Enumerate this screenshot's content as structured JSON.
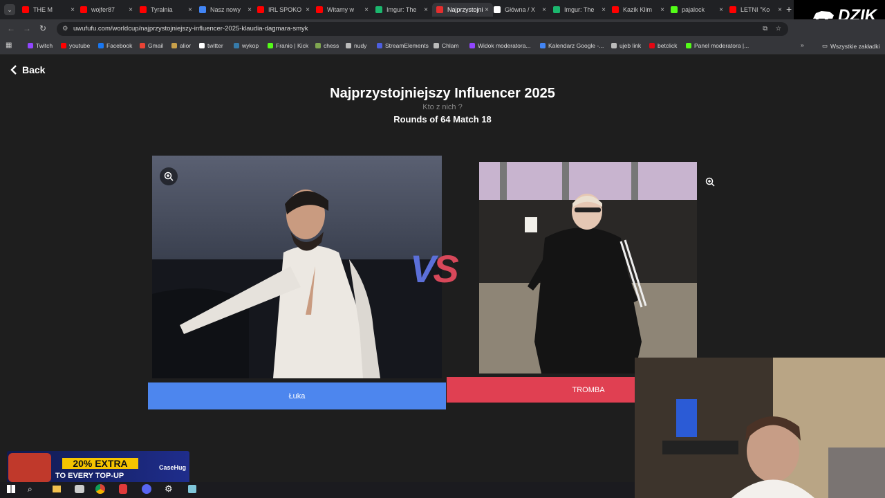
{
  "tabs": [
    {
      "label": "THE M",
      "color": "#ff0000"
    },
    {
      "label": "wojfer87",
      "color": "#ff0000"
    },
    {
      "label": "Tyralnia",
      "color": "#ff0000"
    },
    {
      "label": "Nasz nowy",
      "color": "#4285f4"
    },
    {
      "label": "IRL SPOKO",
      "color": "#ff0000"
    },
    {
      "label": "Witamy w",
      "color": "#ff0000"
    },
    {
      "label": "Imgur: The",
      "color": "#1bb76e"
    },
    {
      "label": "Najprzystojniejszy",
      "color": "#e52e2e",
      "active": true
    },
    {
      "label": "Główna / X",
      "color": "#ffffff"
    },
    {
      "label": "Imgur: The",
      "color": "#1bb76e"
    },
    {
      "label": "Kazik Klim",
      "color": "#ff0000"
    },
    {
      "label": "pajalock",
      "color": "#53fc18"
    },
    {
      "label": "LETNI \"Ko",
      "color": "#ff0000"
    }
  ],
  "address": {
    "url": "uwufufu.com/worldcup/najprzystojniejszy-influencer-2025-klaudia-dagmara-smyk"
  },
  "bookmarks": [
    {
      "label": "Twitch",
      "color": "#9146ff"
    },
    {
      "label": "youtube",
      "color": "#ff0000"
    },
    {
      "label": "Facebook",
      "color": "#1877f2"
    },
    {
      "label": "Gmail",
      "color": "#ea4335"
    },
    {
      "label": "alior",
      "color": "#c8a04a"
    },
    {
      "label": "twitter",
      "color": "#ffffff"
    },
    {
      "label": "wykop",
      "color": "#367aa9"
    },
    {
      "label": "Franio | Kick",
      "color": "#53fc18"
    },
    {
      "label": "chess",
      "color": "#7fa650"
    },
    {
      "label": "nudy",
      "color": "#bbbbbb"
    },
    {
      "label": "StreamElements",
      "color": "#4d5fe0"
    },
    {
      "label": "Chlam",
      "color": "#bbbbbb"
    },
    {
      "label": "Widok moderatora...",
      "color": "#9146ff"
    },
    {
      "label": "Kalendarz Google -...",
      "color": "#4285f4"
    },
    {
      "label": "ujeb link",
      "color": "#bbbbbb"
    },
    {
      "label": "betclick",
      "color": "#e30613"
    },
    {
      "label": "Panel moderatora |...",
      "color": "#53fc18"
    }
  ],
  "bookmarks_all": "Wszystkie zakładki",
  "page": {
    "back": "Back",
    "title": "Najprzystojniejszy Influencer 2025",
    "subtitle": "Kto z nich ?",
    "round": "Rounds of 64 Match 18",
    "vs_v": "V",
    "vs_s": "S",
    "left_name": "Łuka",
    "right_name": "TROMBA"
  },
  "overlay": {
    "brand": "DZIK",
    "promo_line1": "20% EXTRA",
    "promo_line2": "TO EVERY TOP-UP",
    "promo_brand": "CaseHug"
  }
}
